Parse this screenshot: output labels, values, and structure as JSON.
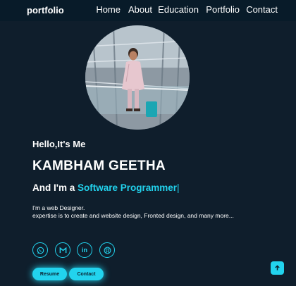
{
  "nav": {
    "brand": "portfolio",
    "links": [
      "Home",
      "About",
      "Education",
      "Portfolio",
      "Contact"
    ]
  },
  "hero": {
    "greeting": "Hello,It's Me",
    "name": "KAMBHAM GEETHA",
    "role_prefix": "And I'm a ",
    "role_highlight": "Software Programmer",
    "cursor": "|",
    "description_line1": "I'm a web Designer.",
    "description_line2": "expertise is to create and website design, Fronted design, and many more..."
  },
  "socials": [
    {
      "icon": "whatsapp-icon"
    },
    {
      "icon": "gmail-icon"
    },
    {
      "icon": "linkedin-icon"
    },
    {
      "icon": "github-icon"
    }
  ],
  "buttons": {
    "resume": "Resume",
    "contact": "Contact"
  },
  "colors": {
    "background": "#0f1e2c",
    "navbar": "#081b29",
    "accent": "#22d3ee"
  }
}
